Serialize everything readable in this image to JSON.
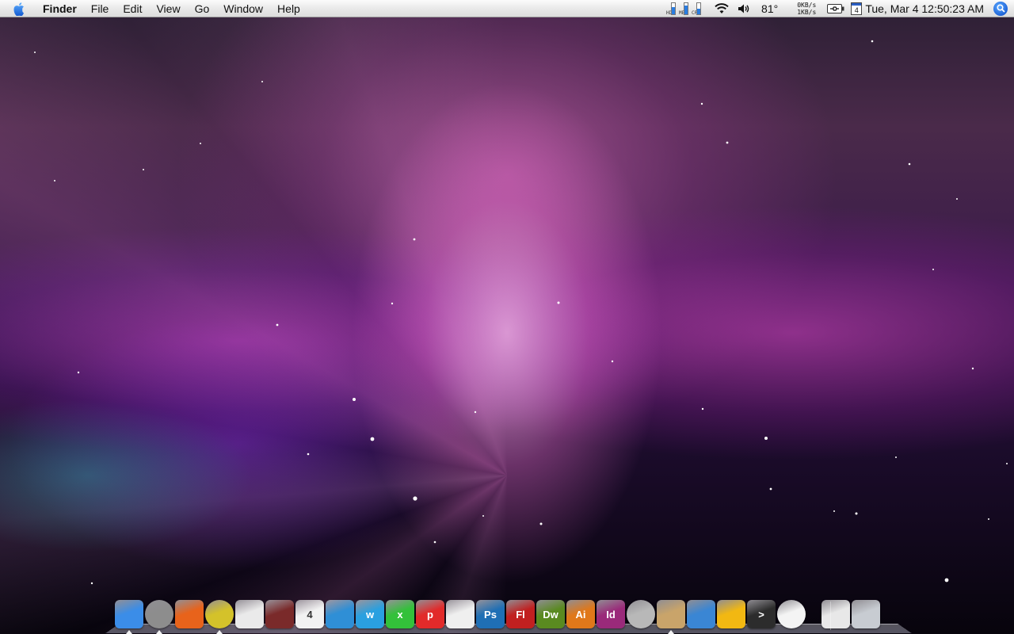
{
  "menubar": {
    "apple_icon": "apple-logo-icon",
    "app_name": "Finder",
    "menus": [
      "File",
      "Edit",
      "View",
      "Go",
      "Window",
      "Help"
    ],
    "status": {
      "meters": [
        {
          "label": "HD",
          "level": 0.6
        },
        {
          "label": "MEM",
          "level": 0.75
        },
        {
          "label": "CPU",
          "level": 0.5
        }
      ],
      "wifi_icon": "wifi-icon",
      "volume_icon": "volume-icon",
      "temperature": "81°",
      "net_down": "0KB/s",
      "net_up": "1KB/s",
      "battery_icon": "battery-plug-icon",
      "calendar_day": "4",
      "clock": "Tue, Mar 4 12:50:23 AM",
      "spotlight_icon": "spotlight-search-icon"
    }
  },
  "dock": {
    "items": [
      {
        "name": "finder-icon",
        "running": true,
        "color": "#3b8de8"
      },
      {
        "name": "safari-compass-icon",
        "running": true,
        "color": "#8d8d8d"
      },
      {
        "name": "firefox-icon",
        "running": false,
        "color": "#e8631b"
      },
      {
        "name": "itunes-cd-icon",
        "running": true,
        "color": "#d4c22a"
      },
      {
        "name": "remote-icon",
        "running": false,
        "color": "#eaeaea"
      },
      {
        "name": "address-book-icon",
        "running": false,
        "color": "#7a2a2a"
      },
      {
        "name": "ical-icon",
        "running": false,
        "color": "#f2f2f2",
        "label": "4"
      },
      {
        "name": "network-utility-icon",
        "running": false,
        "color": "#2f8fd6"
      },
      {
        "name": "word-icon",
        "running": false,
        "color": "#2aa0e0",
        "label": "w"
      },
      {
        "name": "excel-icon",
        "running": false,
        "color": "#33c13a",
        "label": "x"
      },
      {
        "name": "powerpoint-icon",
        "running": false,
        "color": "#e22a2a",
        "label": "p"
      },
      {
        "name": "textedit-icon",
        "running": false,
        "color": "#efefef"
      },
      {
        "name": "photoshop-icon",
        "running": false,
        "color": "#1f6fb5",
        "label": "Ps"
      },
      {
        "name": "flash-icon",
        "running": false,
        "color": "#c12020",
        "label": "Fl"
      },
      {
        "name": "dreamweaver-icon",
        "running": false,
        "color": "#5a8a20",
        "label": "Dw"
      },
      {
        "name": "illustrator-icon",
        "running": false,
        "color": "#e0781a",
        "label": "Ai"
      },
      {
        "name": "indesign-icon",
        "running": false,
        "color": "#9a2a7a",
        "label": "Id"
      },
      {
        "name": "dvd-player-icon",
        "running": false,
        "color": "#b8b8b8"
      },
      {
        "name": "installer-icon",
        "running": true,
        "color": "#c9a46a"
      },
      {
        "name": "xcode-icon",
        "running": false,
        "color": "#3a86d4"
      },
      {
        "name": "loop-app-icon",
        "running": false,
        "color": "#f2b812"
      },
      {
        "name": "terminal-icon",
        "running": false,
        "color": "#2c2c2c",
        "label": ">"
      },
      {
        "name": "ipod-icon",
        "running": false,
        "color": "#f4f4f4"
      },
      {
        "name": "documents-stack-icon",
        "running": false,
        "color": "#e8e8e8"
      },
      {
        "name": "trash-icon",
        "running": false,
        "color": "#c8ccd2"
      }
    ]
  }
}
